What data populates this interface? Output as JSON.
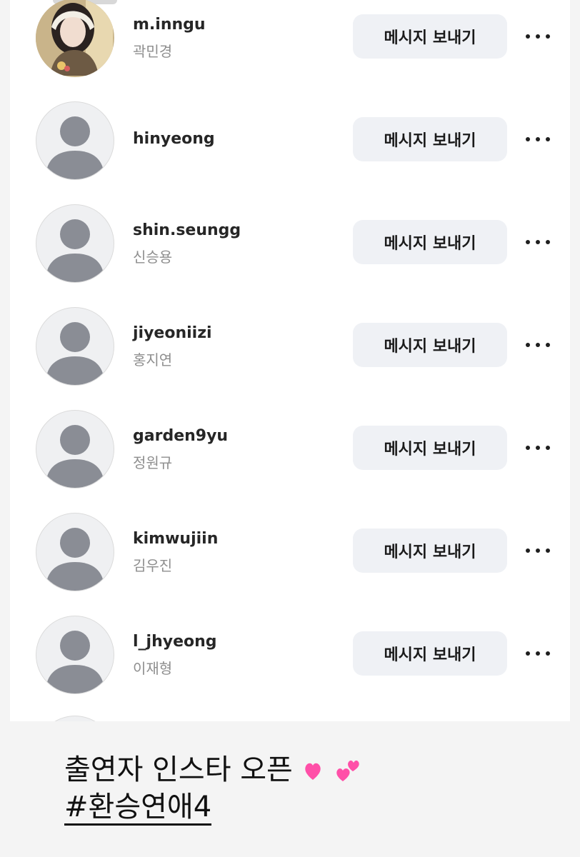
{
  "follow_list": [
    {
      "username": "m.inngu",
      "full_name": "곽민경",
      "avatar": "photo"
    },
    {
      "username": "hinyeong",
      "full_name": "",
      "avatar": "default"
    },
    {
      "username": "shin.seungg",
      "full_name": "신승용",
      "avatar": "default"
    },
    {
      "username": "jiyeoniizi",
      "full_name": "홍지연",
      "avatar": "default"
    },
    {
      "username": "garden9yu",
      "full_name": "정원규",
      "avatar": "default"
    },
    {
      "username": "kimwujiin",
      "full_name": "김우진",
      "avatar": "default"
    },
    {
      "username": "l_jhyeong",
      "full_name": "이재형",
      "avatar": "default"
    }
  ],
  "row_actions": {
    "message_label": "메시지 보내기",
    "more_icon": "more-horizontal-icon"
  },
  "caption": {
    "text": "출연자 인스타 오픈",
    "emoji": "two-hearts",
    "hashtag": "#환승연애4"
  },
  "colors": {
    "username": "#262626",
    "full_name": "#8e8e8e",
    "button_bg": "#eff1f5",
    "default_avatar_bg": "#eff0f2",
    "default_avatar_fg": "#8a8d95",
    "heart": "#ff4fa8"
  }
}
